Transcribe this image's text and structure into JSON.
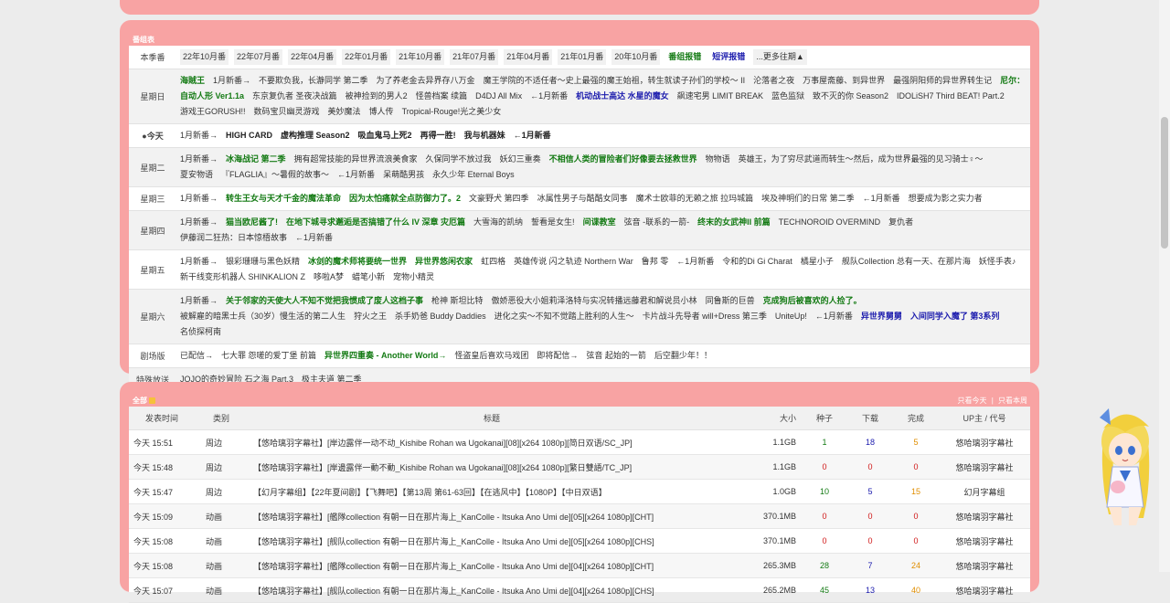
{
  "bangumi": {
    "title": "番组表",
    "season_label": "本季番",
    "seasons": [
      "22年10月番",
      "22年07月番",
      "22年04月番",
      "22年01月番",
      "21年10月番",
      "21年07月番",
      "21年04月番",
      "21年01月番",
      "20年10月番"
    ],
    "season_links": [
      "番组报错",
      "短评报错"
    ],
    "more": "...更多往期▲",
    "days": [
      {
        "label": "星期日",
        "items": [
          {
            "t": "海賊王",
            "s": "g"
          },
          {
            "t": "1月新番→"
          },
          {
            "t": "不要欺负我，长瀞同学 第二季"
          },
          {
            "t": "为了养老金去异界存八万金"
          },
          {
            "t": "魔王学院的不适任者～史上最强的魔王始祖，转生就读子孙们的学校～ II"
          },
          {
            "t": "沦落者之夜"
          },
          {
            "t": "万事屋斋藤、到异世界"
          },
          {
            "t": "最强阴阳师的异世界转生记"
          },
          {
            "t": "尼尔：自动人形 Ver1.1a",
            "s": "g",
            "bw": true
          },
          {
            "t": "东京复仇者 圣夜决战篇"
          },
          {
            "t": "被神捡到的男人2"
          },
          {
            "t": "怪兽档案 续篇"
          },
          {
            "t": "D4DJ All Mix"
          },
          {
            "t": "←1月新番"
          },
          {
            "t": "机动战士高达 水星的魔女",
            "s": "b"
          },
          {
            "t": "飙速宅男 LIMIT BREAK"
          },
          {
            "t": "蓝色监狱"
          },
          {
            "t": "致不灭的你 Season2"
          },
          {
            "t": "IDOLiSH7 Third BEAT! Part.2"
          },
          {
            "t": "游戏王GORUSH!!"
          },
          {
            "t": "数码宝贝幽灵游戏"
          },
          {
            "t": "美妙魔法"
          },
          {
            "t": "博人传"
          },
          {
            "t": "Tropical-Rouge!光之美少女"
          }
        ]
      },
      {
        "label": "●今天",
        "today": true,
        "items": [
          {
            "t": "1月新番→"
          },
          {
            "t": "HIGH CARD",
            "s": "k"
          },
          {
            "t": "虚构推理 Season2",
            "s": "k"
          },
          {
            "t": "吸血鬼马上死2",
            "s": "k"
          },
          {
            "t": "再得一胜!",
            "s": "k"
          },
          {
            "t": "我与机器妹",
            "s": "k"
          },
          {
            "t": "←1月新番",
            "s": "k"
          }
        ]
      },
      {
        "label": "星期二",
        "items": [
          {
            "t": "1月新番→"
          },
          {
            "t": "冰海战记 第二季",
            "s": "g"
          },
          {
            "t": "拥有超常技能的异世界流浪美食家"
          },
          {
            "t": "久保同学不放过我"
          },
          {
            "t": "妖幻三重奏"
          },
          {
            "t": "不相信人类的冒险者们好像要去拯救世界",
            "s": "g"
          },
          {
            "t": "物物语"
          },
          {
            "t": "英雄王，为了穷尽武道而转生～然后，成为世界最强的见习骑士♀～"
          },
          {
            "t": "夏安物语"
          },
          {
            "t": "『FLAGLIA』～暑假的故事～"
          },
          {
            "t": "←1月新番"
          },
          {
            "t": "呆萌酷男孩"
          },
          {
            "t": "永久少年 Eternal Boys"
          }
        ]
      },
      {
        "label": "星期三",
        "items": [
          {
            "t": "1月新番→"
          },
          {
            "t": "转生王女与天才千金的魔法革命",
            "s": "g"
          },
          {
            "t": "因为太怕痛就全点防御力了。2",
            "s": "g"
          },
          {
            "t": "文豪野犬 第四季"
          },
          {
            "t": "冰属性男子与酷酷女同事"
          },
          {
            "t": "魔术士欧菲的无赖之旅 拉玛城篇"
          },
          {
            "t": "埃及神明们的日常 第二季"
          },
          {
            "t": "←1月新番"
          },
          {
            "t": "想要成为影之实力者"
          }
        ]
      },
      {
        "label": "星期四",
        "items": [
          {
            "t": "1月新番→"
          },
          {
            "t": "猫当欧尼酱了!",
            "s": "g"
          },
          {
            "t": "在地下城寻求邂逅是否搞错了什么 IV 深章 灾厄篇",
            "s": "g"
          },
          {
            "t": "大雪海的凯纳"
          },
          {
            "t": "誓看是女生!"
          },
          {
            "t": "间谍教室",
            "s": "g"
          },
          {
            "t": "弦音 -联系的一箭-"
          },
          {
            "t": "终末的女武神II 前篇",
            "s": "g"
          },
          {
            "t": "TECHNOROID OVERMIND"
          },
          {
            "t": "复仇者"
          },
          {
            "t": "伊藤润二狂热：日本惊梧故事"
          },
          {
            "t": "←1月新番"
          }
        ]
      },
      {
        "label": "星期五",
        "items": [
          {
            "t": "1月新番→"
          },
          {
            "t": "银彩珊珊与黑色妖精"
          },
          {
            "t": "冰剑的魔术师将要统一世界",
            "s": "g"
          },
          {
            "t": "异世界悠闲农家",
            "s": "g"
          },
          {
            "t": "虹四格"
          },
          {
            "t": "英雄传说 闪之轨迹 Northern War"
          },
          {
            "t": "鲁邦 零"
          },
          {
            "t": "←1月新番"
          },
          {
            "t": "令和的Di Gi Charat"
          },
          {
            "t": "橘星小子"
          },
          {
            "t": "舰队Collection 总有一天、在那片海"
          },
          {
            "t": "妖怪手表♪"
          },
          {
            "t": "新干线变形机器人 SHINKALION Z"
          },
          {
            "t": "哆啦A梦"
          },
          {
            "t": "蜡笔小新"
          },
          {
            "t": "宠物小精灵"
          }
        ]
      },
      {
        "label": "星期六",
        "items": [
          {
            "t": "1月新番→"
          },
          {
            "t": "关于邻家的天使大人不知不觉把我惯成了废人这档子事",
            "s": "g"
          },
          {
            "t": "枪神 斯坦比特"
          },
          {
            "t": "傲娇恶役大小姐莉泽洛特与实况转播远藤君和解说员小林"
          },
          {
            "t": "同鲁斯的巨兽"
          },
          {
            "t": "克成狗后被喜欢的人捡了。",
            "s": "g"
          },
          {
            "t": "被解雇的暗黑士兵（30岁）慢生活的第二人生"
          },
          {
            "t": "狩火之王"
          },
          {
            "t": "杀手奶爸 Buddy Daddies"
          },
          {
            "t": "进化之实～不知不觉踏上胜利的人生～"
          },
          {
            "t": "卡片战斗先导者 will+Dress 第三季"
          },
          {
            "t": "UniteUp!"
          },
          {
            "t": "←1月新番"
          },
          {
            "t": "异世界舅舅",
            "s": "b"
          },
          {
            "t": "入间同学入魔了 第3系列",
            "s": "b"
          },
          {
            "t": "名侦探柯南"
          }
        ]
      },
      {
        "label": "剧场版",
        "items": [
          {
            "t": "已配信→"
          },
          {
            "t": "七大罪 怨嗟的爱丁堡 前篇"
          },
          {
            "t": "异世界四重奏 - Another World→",
            "s": "g"
          },
          {
            "t": "怪盗皇后喜欢马戏团"
          },
          {
            "t": "即将配信→"
          },
          {
            "t": "弦音 起始的一箭"
          },
          {
            "t": "后空翻少年！！"
          }
        ]
      },
      {
        "label": "特殊放送",
        "items": [
          {
            "t": "JOJO的奇妙冒险 石之海 Part.3"
          },
          {
            "t": "极主夫道 第二季"
          }
        ]
      }
    ]
  },
  "all": {
    "title": "全部",
    "links": [
      "只看今天",
      "|",
      "只看本周"
    ],
    "headers": [
      "发表时间",
      "类别",
      "标题",
      "大小",
      "种子",
      "下载",
      "完成",
      "UP主 / 代号"
    ],
    "rows": [
      {
        "time": "今天 15:51",
        "cat": "周边",
        "title": "【悠哈璃羽字幕社】[岸边露伴一动不动_Kishibe Rohan wa Ugokanai][08][x264 1080p][简日双语/SC_JP]",
        "size": "1.1GB",
        "seed": "1",
        "dl": "18",
        "done": "5",
        "up": "悠哈璃羽字幕社"
      },
      {
        "time": "今天 15:48",
        "cat": "周边",
        "title": "【悠哈璃羽字幕社】[岸邊露伴一動不動_Kishibe Rohan wa Ugokanai][08][x264 1080p][繁日雙語/TC_JP]",
        "size": "1.1GB",
        "seed": "0",
        "dl": "0",
        "done": "0",
        "up": "悠哈璃羽字幕社"
      },
      {
        "time": "今天 15:47",
        "cat": "周边",
        "title": "【幻月字幕组】【22年夏间剧】【飞舞吧】【第13周 第61-63回】【在逃风中】【1080P】【中日双语】",
        "size": "1.0GB",
        "seed": "10",
        "dl": "5",
        "done": "15",
        "up": "幻月字幕组"
      },
      {
        "time": "今天 15:09",
        "cat": "动画",
        "title": "【悠哈璃羽字幕社】[艦隊collection 有朝一日在那片海上_KanColle - Itsuka Ano Umi de][05][x264 1080p][CHT]",
        "size": "370.1MB",
        "seed": "0",
        "dl": "0",
        "done": "0",
        "up": "悠哈璃羽字幕社"
      },
      {
        "time": "今天 15:08",
        "cat": "动画",
        "title": "【悠哈璃羽字幕社】[舰队collection 有朝一日在那片海上_KanColle - Itsuka Ano Umi de][05][x264 1080p][CHS]",
        "size": "370.1MB",
        "seed": "0",
        "dl": "0",
        "done": "0",
        "up": "悠哈璃羽字幕社"
      },
      {
        "time": "今天 15:08",
        "cat": "动画",
        "title": "【悠哈璃羽字幕社】[艦隊collection 有朝一日在那片海上_KanColle - Itsuka Ano Umi de][04][x264 1080p][CHT]",
        "size": "265.3MB",
        "seed": "28",
        "dl": "7",
        "done": "24",
        "up": "悠哈璃羽字幕社"
      },
      {
        "time": "今天 15:07",
        "cat": "动画",
        "title": "【悠哈璃羽字幕社】[舰队collection 有朝一日在那片海上_KanColle - Itsuka Ano Umi de][04][x264 1080p][CHS]",
        "size": "265.2MB",
        "seed": "45",
        "dl": "13",
        "done": "40",
        "up": "悠哈璃羽字幕社"
      }
    ]
  },
  "colors": {
    "panel": "#f8a3a3",
    "green": "#137a13",
    "blue": "#1b1bad",
    "orange": "#e08e00",
    "red": "#d01818"
  }
}
